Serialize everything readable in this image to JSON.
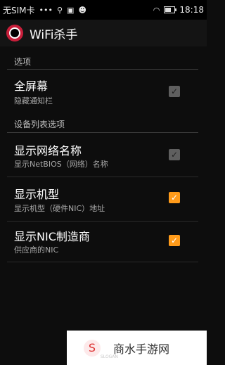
{
  "status_bar": {
    "carrier": "无SIM卡",
    "time": "18:18",
    "icons": [
      "usb-icon",
      "image-icon",
      "android-icon",
      "wifi-icon",
      "battery-icon"
    ]
  },
  "app_bar": {
    "title": "WiFi杀手",
    "logo_icon": "app-logo-icon"
  },
  "sections": [
    {
      "header": "选项"
    },
    {
      "header": "设备列表选项"
    }
  ],
  "items": [
    {
      "title": "全屏幕",
      "subtitle": "隐藏通知栏",
      "checked": true,
      "enabled": false
    },
    {
      "title": "显示网络名称",
      "subtitle": "显示NetBIOS（网络）名称",
      "checked": true,
      "enabled": false
    },
    {
      "title": "显示机型",
      "subtitle": "显示机型（硬件NIC）地址",
      "checked": true,
      "enabled": true
    },
    {
      "title": "显示NIC制造商",
      "subtitle": "供应商的NIC",
      "checked": true,
      "enabled": true
    }
  ],
  "watermark": {
    "text": "商水手游网",
    "small": "SLOGAN"
  },
  "colors": {
    "accent": "#ff9b1a",
    "logo": "#c81e3a"
  }
}
